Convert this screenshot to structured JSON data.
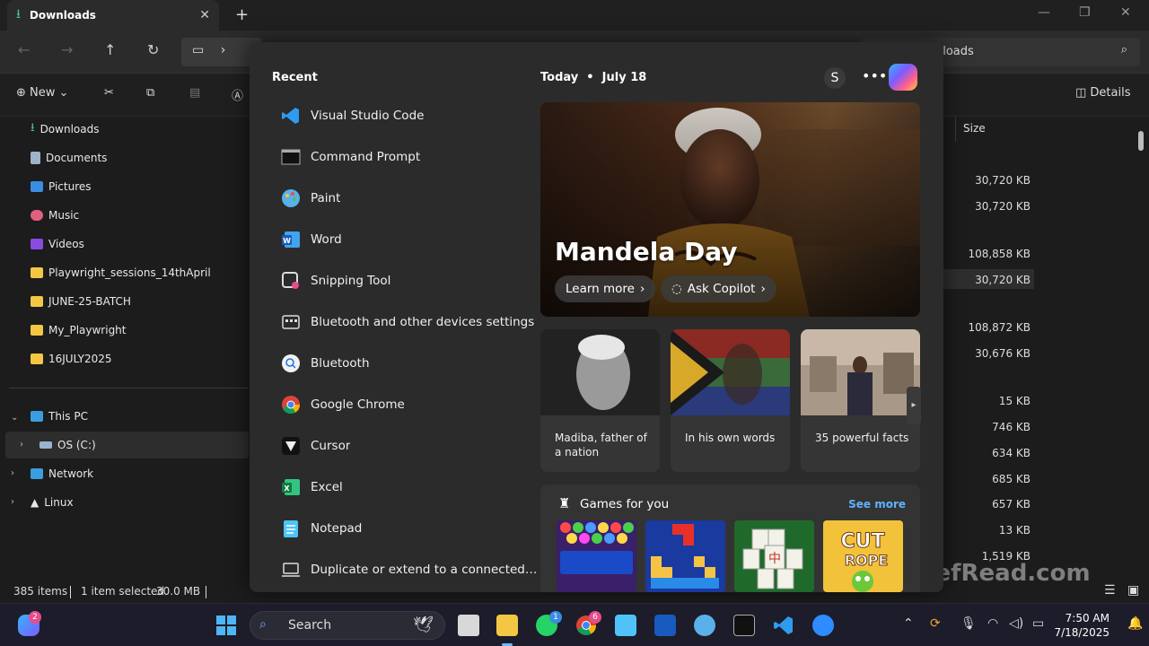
{
  "explorer": {
    "tab_title": "Downloads",
    "search_placeholder": "nloads",
    "new_label": "New",
    "details_label": "Details",
    "sidebar": {
      "quick": [
        "Downloads",
        "Documents",
        "Pictures",
        "Music",
        "Videos",
        "Playwright_sessions_14thApril",
        "JUNE-25-BATCH",
        "My_Playwright",
        "16JULY2025"
      ],
      "this_pc": "This PC",
      "os": "OS (C:)",
      "network": "Network",
      "linux": "Linux"
    },
    "column_size": "Size",
    "sizes": [
      "30,720 KB",
      "30,720 KB",
      "108,858 KB",
      "30,720 KB",
      "108,872 KB",
      "30,676 KB",
      "15 KB",
      "746 KB",
      "634 KB",
      "685 KB",
      "657 KB",
      "13 KB",
      "1,519 KB"
    ],
    "status": {
      "items": "385 items",
      "selected": "1 item selected",
      "selected_size": "30.0 MB"
    }
  },
  "start": {
    "recent_heading": "Recent",
    "apps": [
      {
        "label": "Visual Studio Code",
        "icon": "vscode-icon"
      },
      {
        "label": "Command Prompt",
        "icon": "command-prompt-icon"
      },
      {
        "label": "Paint",
        "icon": "paint-icon"
      },
      {
        "label": "Word",
        "icon": "word-icon"
      },
      {
        "label": "Snipping Tool",
        "icon": "snipping-tool-icon"
      },
      {
        "label": "Bluetooth and other devices settings",
        "icon": "settings-icon"
      },
      {
        "label": "Bluetooth",
        "icon": "bluetooth-icon"
      },
      {
        "label": "Google Chrome",
        "icon": "chrome-icon"
      },
      {
        "label": "Cursor",
        "icon": "cursor-icon"
      },
      {
        "label": "Excel",
        "icon": "excel-icon"
      },
      {
        "label": "Notepad",
        "icon": "notepad-icon"
      },
      {
        "label": "Duplicate or extend to a connected di...",
        "icon": "display-icon"
      }
    ],
    "today_label": "Today",
    "date_label": "July 18",
    "avatar_letter": "S",
    "hero": {
      "title": "Mandela Day",
      "learn_more": "Learn more",
      "ask_copilot": "Ask Copilot"
    },
    "cards": [
      "Madiba, father of a nation",
      "In his own words",
      "35 powerful facts"
    ],
    "games": {
      "title": "Games for you",
      "see_more": "See more",
      "items": [
        "Bubble Shooter HD",
        "Block Puzzle",
        "Mahjong",
        "Cut the Rope"
      ]
    }
  },
  "watermark": "BriefRead.com",
  "taskbar": {
    "search_text": "Search",
    "copilot_badge": "2",
    "whatsapp_badge": "1",
    "chrome_badge": "6",
    "time": "7:50 AM",
    "date": "7/18/2025"
  },
  "colors": {
    "accent": "#5fb2ff",
    "folder": "#f3c744",
    "start_bg": "#2b2b2b"
  }
}
